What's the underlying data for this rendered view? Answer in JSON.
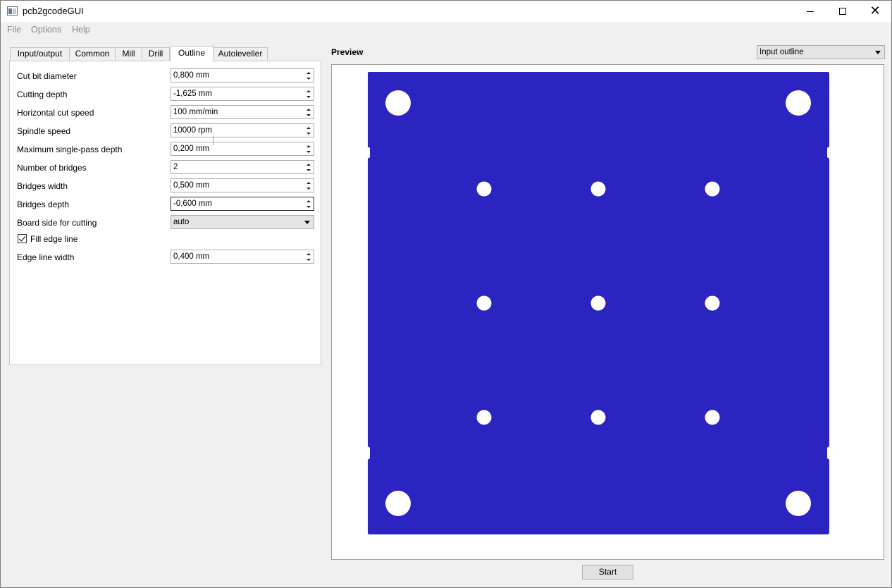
{
  "window": {
    "title": "pcb2gcodeGUI"
  },
  "menu": {
    "file": "File",
    "options": "Options",
    "help": "Help"
  },
  "tabs": {
    "io": "Input/output",
    "common": "Common",
    "mill": "Mill",
    "drill": "Drill",
    "outline": "Outline",
    "autoleveller": "Autoleveller",
    "active": "Outline"
  },
  "outline": {
    "cut_bit_diameter": {
      "label": "Cut bit diameter",
      "value": "0,800 mm"
    },
    "cutting_depth": {
      "label": "Cutting depth",
      "value": "-1,625 mm"
    },
    "horizontal_cut_speed": {
      "label": "Horizontal cut speed",
      "value": "100 mm/min"
    },
    "spindle_speed": {
      "label": "Spindle speed",
      "value": "10000 rpm"
    },
    "max_single_pass_depth": {
      "label": "Maximum single-pass depth",
      "value": "0,200 mm"
    },
    "number_of_bridges": {
      "label": "Number of bridges",
      "value": "2"
    },
    "bridges_width": {
      "label": "Bridges width",
      "value": "0,500 mm"
    },
    "bridges_depth": {
      "label": "Bridges depth",
      "value": "-0,600 mm"
    },
    "board_side": {
      "label": "Board side for cutting",
      "value": "auto"
    },
    "fill_edge_line": {
      "label": "Fill edge line",
      "checked": true
    },
    "edge_line_width": {
      "label": "Edge line width",
      "value": "0,400 mm"
    }
  },
  "preview": {
    "title": "Preview",
    "view_select": "Input outline",
    "board_color": "#2b24c0"
  },
  "start_button": "Start"
}
